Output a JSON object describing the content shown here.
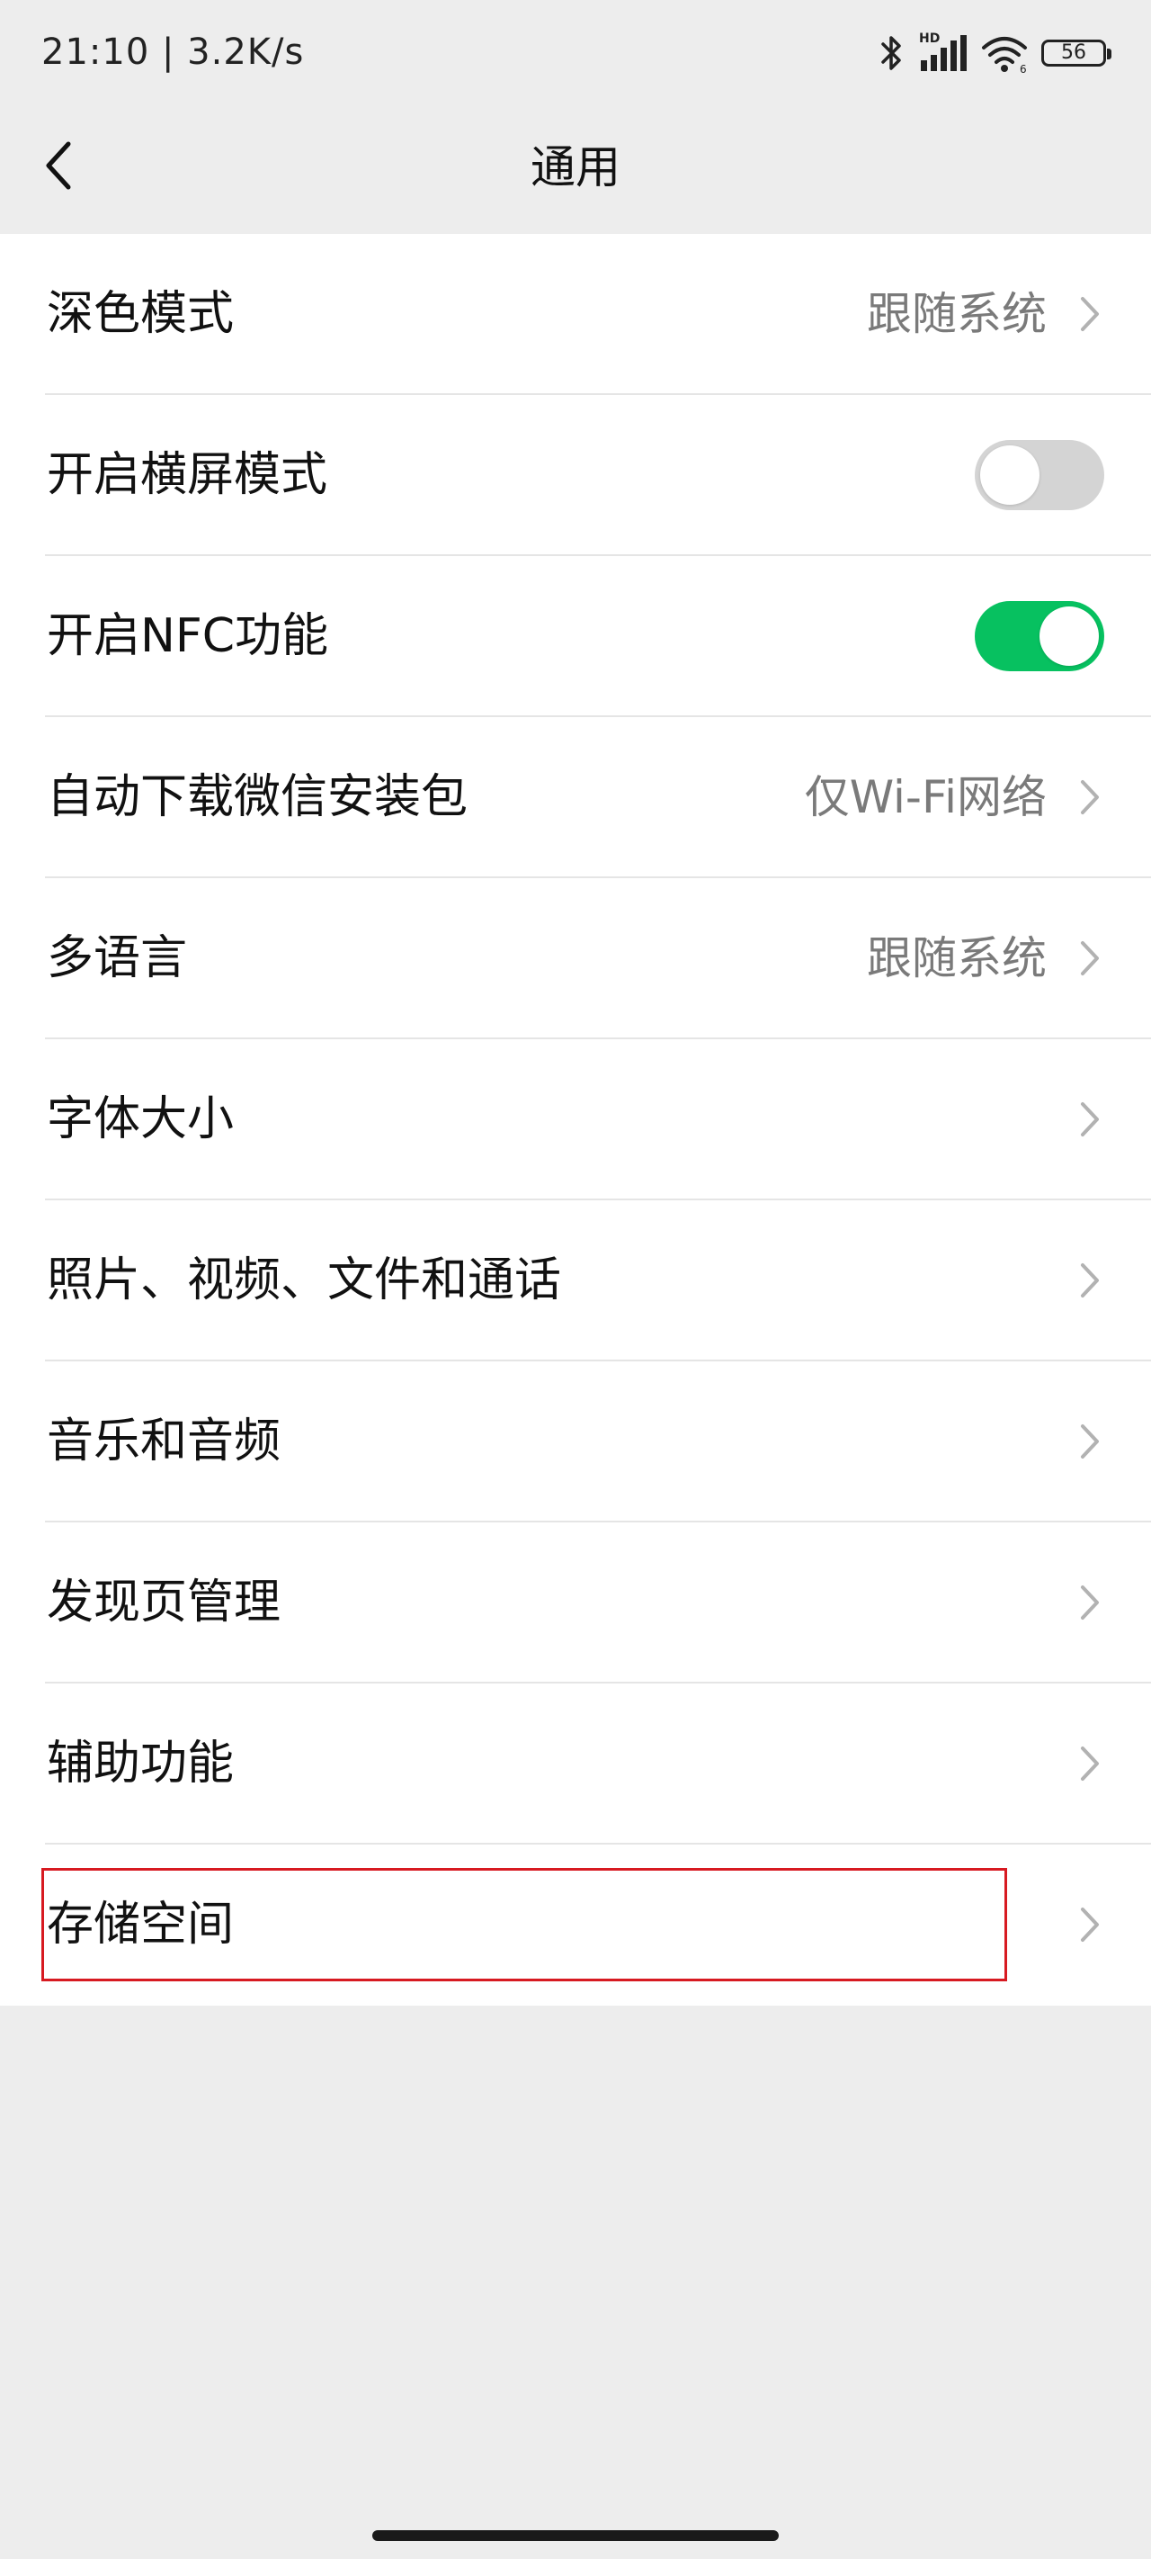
{
  "status_bar": {
    "time_speed": "21:10 | 3.2K/s",
    "network_badge": "HD",
    "battery": "56",
    "icons": [
      "bluetooth-icon",
      "signal-icon",
      "wifi-icon",
      "battery-icon"
    ]
  },
  "nav": {
    "title": "通用",
    "back_icon": "chevron-left-icon"
  },
  "settings": [
    {
      "label": "深色模式",
      "value": "跟随系统",
      "control": "chevron"
    },
    {
      "label": "开启横屏模式",
      "value": "",
      "control": "toggle",
      "toggle_on": false
    },
    {
      "label": "开启NFC功能",
      "value": "",
      "control": "toggle",
      "toggle_on": true
    },
    {
      "label": "自动下载微信安装包",
      "value": "仅Wi-Fi网络",
      "control": "chevron"
    },
    {
      "label": "多语言",
      "value": "跟随系统",
      "control": "chevron"
    },
    {
      "label": "字体大小",
      "value": "",
      "control": "chevron"
    },
    {
      "label": "照片、视频、文件和通话",
      "value": "",
      "control": "chevron"
    },
    {
      "label": "音乐和音频",
      "value": "",
      "control": "chevron"
    },
    {
      "label": "发现页管理",
      "value": "",
      "control": "chevron"
    },
    {
      "label": "辅助功能",
      "value": "",
      "control": "chevron"
    },
    {
      "label": "存储空间",
      "value": "",
      "control": "chevron",
      "highlighted": true
    }
  ],
  "colors": {
    "background": "#ededed",
    "toggle_on": "#07c160",
    "toggle_off": "#d4d4d4",
    "highlight": "#d71a21",
    "secondary_text": "#7a7a7a"
  }
}
